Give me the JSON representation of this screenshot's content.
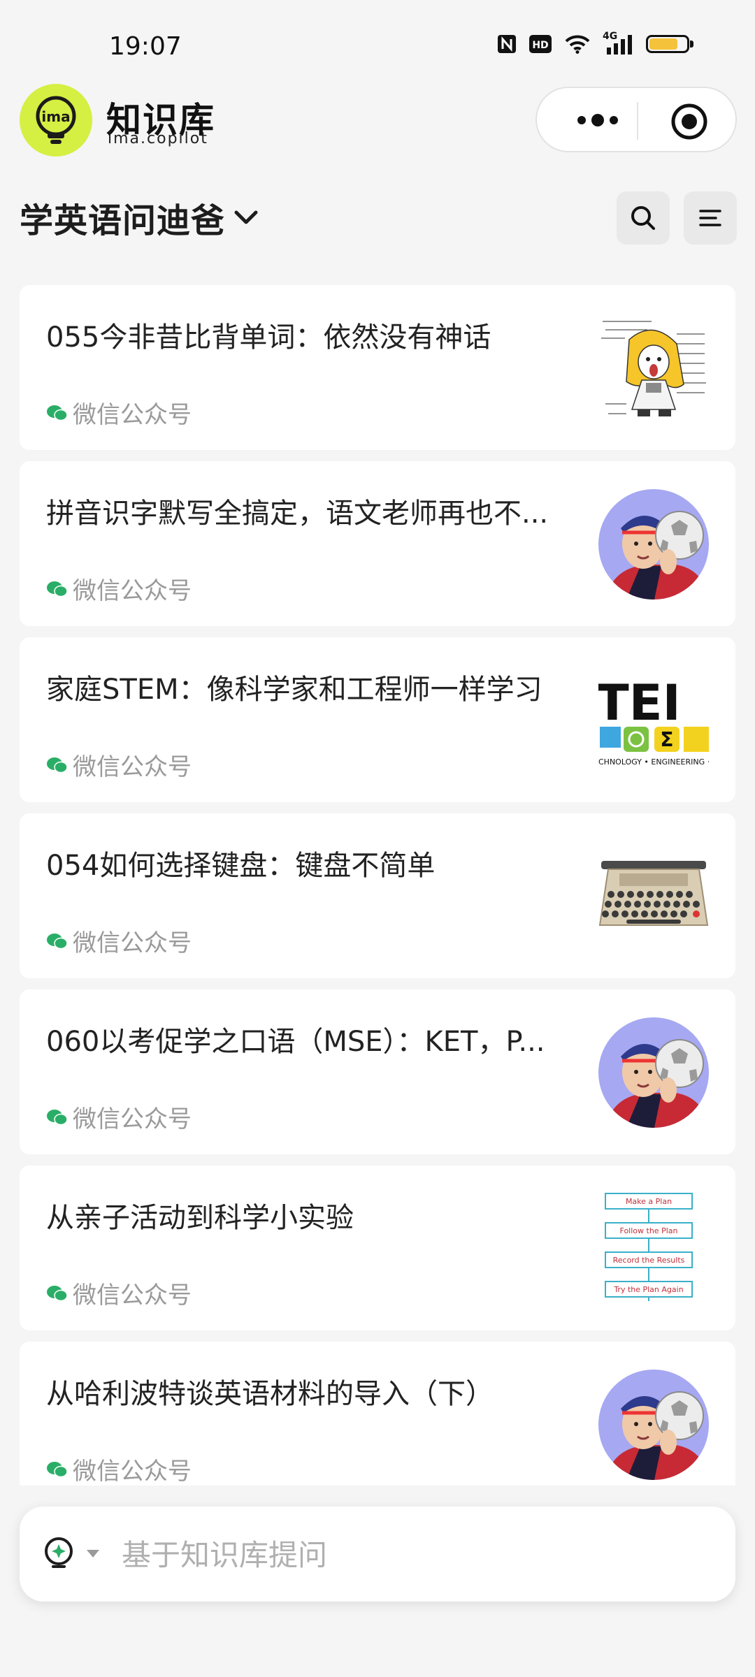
{
  "status_bar": {
    "time": "19:07",
    "network": "4G",
    "hd": "HD",
    "battery_color": "#f5c33b"
  },
  "app": {
    "brand_title": "知识库",
    "brand_subtitle": "ima.copilot",
    "logo_text": "ima",
    "logo_color": "#d6ef43"
  },
  "knowledge_base": {
    "name": "学英语问迪爸"
  },
  "articles": [
    {
      "title": "055今非昔比背单词：依然没有神话",
      "source": "微信公众号",
      "thumb": "cartoon-girl-sketch"
    },
    {
      "title": "拼音识字默写全搞定，语文老师再也不...",
      "source": "微信公众号",
      "thumb": "avatar-boy-football"
    },
    {
      "title": "家庭STEM：像科学家和工程师一样学习",
      "source": "微信公众号",
      "thumb": "stem-logo",
      "thumb_text": "TEI",
      "thumb_caption": "CHNOLOGY • ENGINEERING • M"
    },
    {
      "title": "054如何选择键盘：键盘不简单",
      "source": "微信公众号",
      "thumb": "typewriter"
    },
    {
      "title": "060以考促学之口语（MSE）：KET，P...",
      "source": "微信公众号",
      "thumb": "avatar-boy-football"
    },
    {
      "title": "从亲子活动到科学小实验",
      "source": "微信公众号",
      "thumb": "plan-flowchart",
      "flow_steps": [
        "Make a Plan",
        "Follow the Plan",
        "Record the Results",
        "Try the Plan Again"
      ]
    },
    {
      "title": "从哈利波特谈英语材料的导入（下）",
      "source": "微信公众号",
      "thumb": "avatar-boy-football"
    }
  ],
  "ask_bar": {
    "placeholder": "基于知识库提问"
  },
  "colors": {
    "wechat_green": "#2aae67",
    "background": "#f5f5f5"
  }
}
